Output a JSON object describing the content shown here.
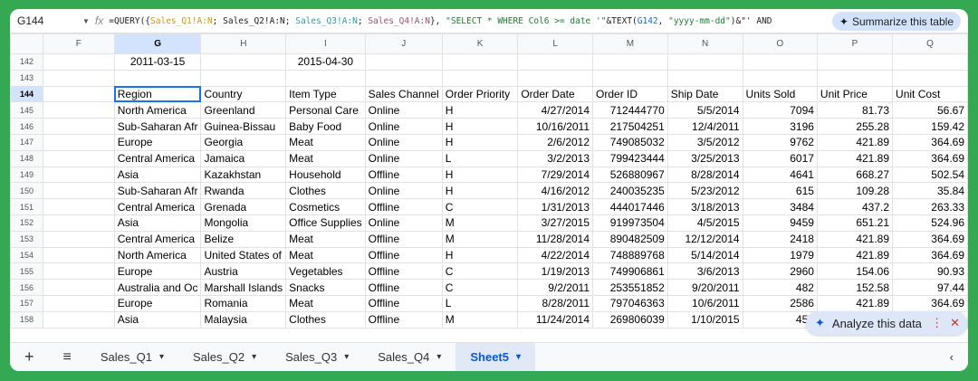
{
  "formula_bar": {
    "cell_ref": "G144",
    "fx": "fx",
    "parts": [
      {
        "t": "=QUERY({",
        "c": ""
      },
      {
        "t": "Sales_Q1!A:N",
        "c": "c1"
      },
      {
        "t": "; ",
        "c": ""
      },
      {
        "t": "Sales_Q2!A:N",
        "c": ""
      },
      {
        "t": "; ",
        "c": ""
      },
      {
        "t": "Sales_Q3!A:N",
        "c": "c2"
      },
      {
        "t": "; ",
        "c": ""
      },
      {
        "t": "Sales_Q4!A:N",
        "c": "c3"
      },
      {
        "t": "}, ",
        "c": ""
      },
      {
        "t": "\"SELECT * WHERE Col6 >= date '\"",
        "c": "c4"
      },
      {
        "t": "&TEXT(",
        "c": ""
      },
      {
        "t": "G142",
        "c": "c5"
      },
      {
        "t": ", ",
        "c": ""
      },
      {
        "t": "\"yyyy-mm-dd\"",
        "c": "c4"
      },
      {
        "t": ")&\"' AND",
        "c": ""
      }
    ]
  },
  "summarize_label": "Summarize this table",
  "columns": [
    "F",
    "G",
    "H",
    "I",
    "J",
    "K",
    "L",
    "M",
    "N",
    "O",
    "P",
    "Q"
  ],
  "rows": [
    {
      "n": "142",
      "cells": [
        "",
        "2011-03-15",
        "",
        "2015-04-30",
        "",
        "",
        "",
        "",
        "",
        "",
        "",
        ""
      ]
    },
    {
      "n": "143",
      "cells": [
        "",
        "",
        "",
        "",
        "",
        "",
        "",
        "",
        "",
        "",
        "",
        ""
      ]
    },
    {
      "n": "144",
      "cells": [
        "",
        "Region",
        "Country",
        "Item Type",
        "Sales Channel",
        "Order Priority",
        "Order Date",
        "Order ID",
        "Ship Date",
        "Units Sold",
        "Unit Price",
        "Unit Cost"
      ]
    },
    {
      "n": "145",
      "cells": [
        "",
        "North America",
        "Greenland",
        "Personal Care",
        "Online",
        "H",
        "4/27/2014",
        "712444770",
        "5/5/2014",
        "7094",
        "81.73",
        "56.67"
      ]
    },
    {
      "n": "146",
      "cells": [
        "",
        "Sub-Saharan Afr",
        "Guinea-Bissau",
        "Baby Food",
        "Online",
        "H",
        "10/16/2011",
        "217504251",
        "12/4/2011",
        "3196",
        "255.28",
        "159.42"
      ]
    },
    {
      "n": "147",
      "cells": [
        "",
        "Europe",
        "Georgia",
        "Meat",
        "Online",
        "H",
        "2/6/2012",
        "749085032",
        "3/5/2012",
        "9762",
        "421.89",
        "364.69"
      ]
    },
    {
      "n": "148",
      "cells": [
        "",
        "Central America",
        "Jamaica",
        "Meat",
        "Online",
        "L",
        "3/2/2013",
        "799423444",
        "3/25/2013",
        "6017",
        "421.89",
        "364.69"
      ]
    },
    {
      "n": "149",
      "cells": [
        "",
        "Asia",
        "Kazakhstan",
        "Household",
        "Offline",
        "H",
        "7/29/2014",
        "526880967",
        "8/28/2014",
        "4641",
        "668.27",
        "502.54"
      ]
    },
    {
      "n": "150",
      "cells": [
        "",
        "Sub-Saharan Afr",
        "Rwanda",
        "Clothes",
        "Online",
        "H",
        "4/16/2012",
        "240035235",
        "5/23/2012",
        "615",
        "109.28",
        "35.84"
      ]
    },
    {
      "n": "151",
      "cells": [
        "",
        "Central America",
        "Grenada",
        "Cosmetics",
        "Offline",
        "C",
        "1/31/2013",
        "444017446",
        "3/18/2013",
        "3484",
        "437.2",
        "263.33"
      ]
    },
    {
      "n": "152",
      "cells": [
        "",
        "Asia",
        "Mongolia",
        "Office Supplies",
        "Online",
        "M",
        "3/27/2015",
        "919973504",
        "4/5/2015",
        "9459",
        "651.21",
        "524.96"
      ]
    },
    {
      "n": "153",
      "cells": [
        "",
        "Central America",
        "Belize",
        "Meat",
        "Offline",
        "M",
        "11/28/2014",
        "890482509",
        "12/12/2014",
        "2418",
        "421.89",
        "364.69"
      ]
    },
    {
      "n": "154",
      "cells": [
        "",
        "North America",
        "United States of",
        "Meat",
        "Offline",
        "H",
        "4/22/2014",
        "748889768",
        "5/14/2014",
        "1979",
        "421.89",
        "364.69"
      ]
    },
    {
      "n": "155",
      "cells": [
        "",
        "Europe",
        "Austria",
        "Vegetables",
        "Offline",
        "C",
        "1/19/2013",
        "749906861",
        "3/6/2013",
        "2960",
        "154.06",
        "90.93"
      ]
    },
    {
      "n": "156",
      "cells": [
        "",
        "Australia and Oc",
        "Marshall Islands",
        "Snacks",
        "Offline",
        "C",
        "9/2/2011",
        "253551852",
        "9/20/2011",
        "482",
        "152.58",
        "97.44"
      ]
    },
    {
      "n": "157",
      "cells": [
        "",
        "Europe",
        "Romania",
        "Meat",
        "Offline",
        "L",
        "8/28/2011",
        "797046363",
        "10/6/2011",
        "2586",
        "421.89",
        "364.69"
      ]
    },
    {
      "n": "158",
      "cells": [
        "",
        "Asia",
        "Malaysia",
        "Clothes",
        "Offline",
        "M",
        "11/24/2014",
        "269806039",
        "1/10/2015",
        "457",
        "",
        ""
      ]
    }
  ],
  "sheet_tabs": [
    {
      "label": "Sales_Q1"
    },
    {
      "label": "Sales_Q2"
    },
    {
      "label": "Sales_Q3"
    },
    {
      "label": "Sales_Q4"
    },
    {
      "label": "Sheet5",
      "active": true
    }
  ],
  "analyze_label": "Analyze this data",
  "accent": "#1a73e8",
  "frame_color": "#34a853"
}
